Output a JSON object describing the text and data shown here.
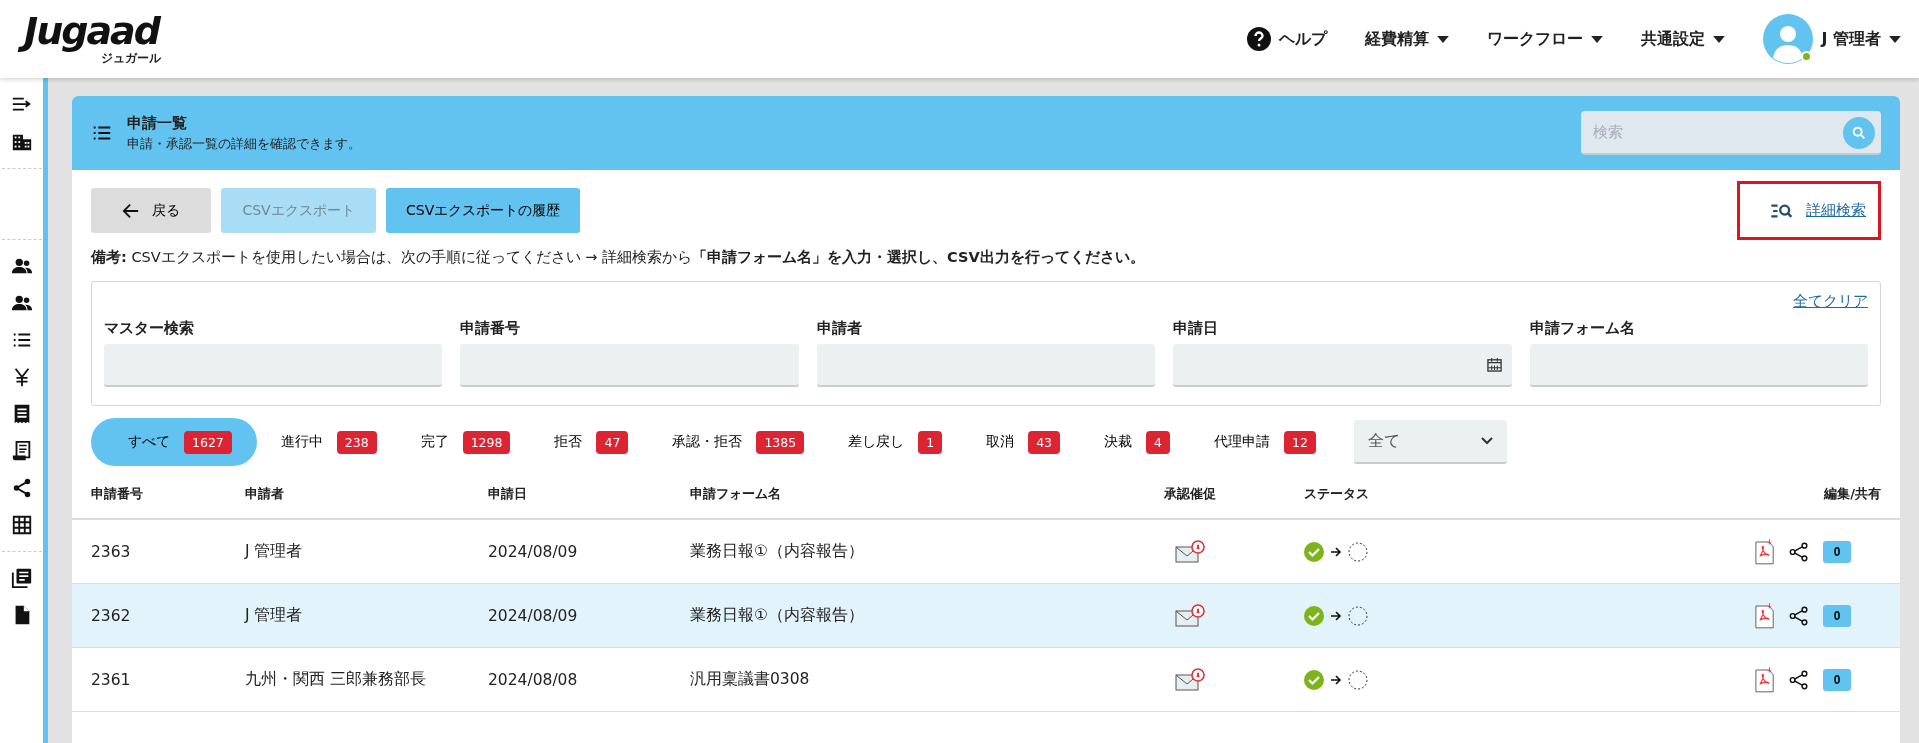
{
  "logo": {
    "wordmark": "Jugaad",
    "kana": "ジュガール"
  },
  "nav": [
    {
      "kind": "help",
      "label": "ヘルプ"
    },
    {
      "kind": "menu",
      "label": "経費精算"
    },
    {
      "kind": "menu",
      "label": "ワークフロー"
    },
    {
      "kind": "menu",
      "label": "共通設定"
    }
  ],
  "user": {
    "name": "J 管理者",
    "online": true
  },
  "page": {
    "title": "申請一覧",
    "subtitle": "申請・承認一覧の詳細を確認できます。",
    "search_placeholder": "検索"
  },
  "buttons": [
    {
      "kind": "back",
      "label": "戻る",
      "disabled": false
    },
    {
      "kind": "export",
      "label": "CSVエクスポート",
      "disabled": true
    },
    {
      "kind": "history",
      "label": "CSVエクスポートの履歴",
      "disabled": false
    }
  ],
  "advanced_search": {
    "label": "詳細検索",
    "highlighted": true
  },
  "note": "**備考:** CSVエクスポートを使用したい場合は、次の手順に従ってください → 詳細検索から**「申請フォーム名」を入力・選択し、CSV出力を行ってください。**",
  "filters": {
    "clear": "全てクリア",
    "fields": [
      {
        "label": "マスター検索",
        "kind": "text"
      },
      {
        "label": "申請番号",
        "kind": "text"
      },
      {
        "label": "申請者",
        "kind": "text"
      },
      {
        "label": "申請日",
        "kind": "date"
      },
      {
        "label": "申請フォーム名",
        "kind": "text"
      }
    ]
  },
  "status_tabs": [
    {
      "label": "すべて",
      "count": "1627",
      "selected": true
    },
    {
      "label": "進行中",
      "count": "238",
      "selected": false
    },
    {
      "label": "完了",
      "count": "1298",
      "selected": false
    },
    {
      "label": "拒否",
      "count": "47",
      "selected": false
    },
    {
      "label": "承認・拒否",
      "count": "1385",
      "selected": false
    },
    {
      "label": "差し戻し",
      "count": "1",
      "selected": false
    },
    {
      "label": "取消",
      "count": "43",
      "selected": false
    },
    {
      "label": "決裁",
      "count": "4",
      "selected": false
    },
    {
      "label": "代理申請",
      "count": "12",
      "selected": false
    }
  ],
  "scope_select": {
    "value": "全て"
  },
  "table": {
    "columns": [
      "申請番号",
      "申請者",
      "申請日",
      "申請フォーム名",
      "承認催促",
      "ステータス",
      "編集/共有"
    ],
    "rows": [
      {
        "number": "2363",
        "applicant": "J 管理者",
        "date": "2024/08/09",
        "form": "業務日報①（内容報告）",
        "comments": "0",
        "selected": false
      },
      {
        "number": "2362",
        "applicant": "J 管理者",
        "date": "2024/08/09",
        "form": "業務日報①（内容報告）",
        "comments": "0",
        "selected": true
      },
      {
        "number": "2361",
        "applicant": "九州・関西 三郎兼務部長",
        "date": "2024/08/08",
        "form": "汎用稟議書0308",
        "comments": "0",
        "selected": false
      }
    ]
  }
}
